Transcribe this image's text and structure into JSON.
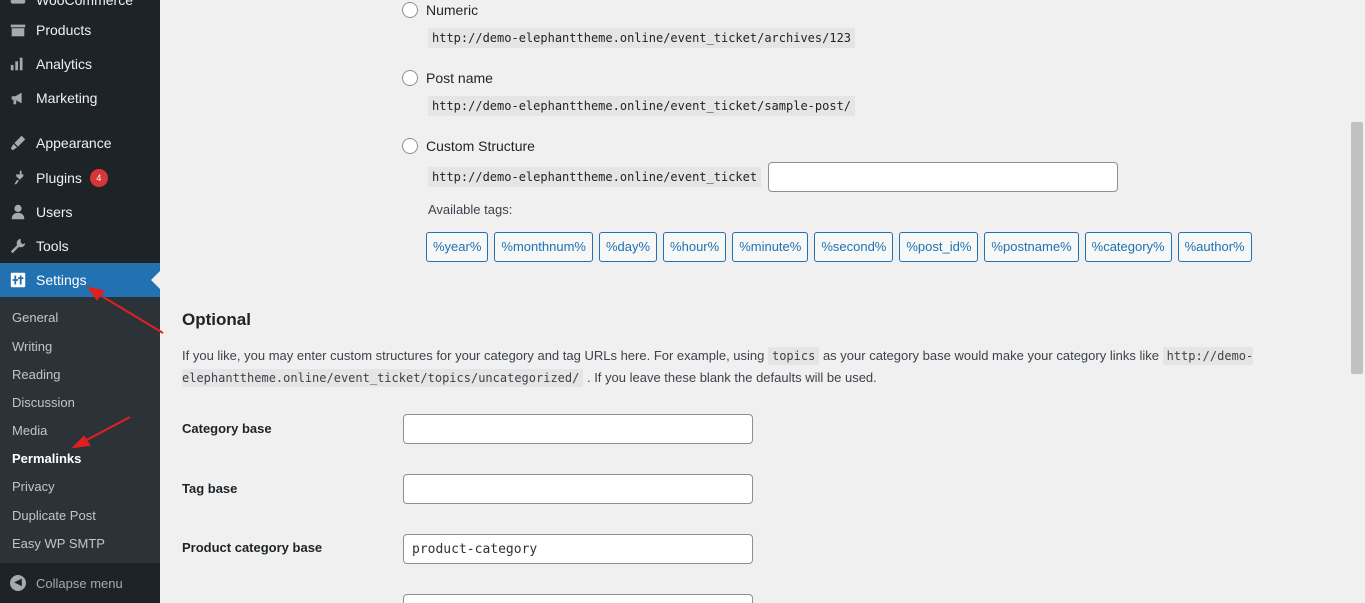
{
  "sidebar": {
    "items": [
      {
        "label": "WooCommerce",
        "icon": "woocommerce-icon"
      },
      {
        "label": "Products",
        "icon": "products-icon"
      },
      {
        "label": "Analytics",
        "icon": "analytics-icon"
      },
      {
        "label": "Marketing",
        "icon": "marketing-icon"
      },
      {
        "label": "Appearance",
        "icon": "appearance-icon"
      },
      {
        "label": "Plugins",
        "icon": "plugins-icon",
        "badge": "4"
      },
      {
        "label": "Users",
        "icon": "users-icon"
      },
      {
        "label": "Tools",
        "icon": "tools-icon"
      },
      {
        "label": "Settings",
        "icon": "settings-icon"
      }
    ],
    "submenu": [
      "General",
      "Writing",
      "Reading",
      "Discussion",
      "Media",
      "Permalinks",
      "Privacy",
      "Duplicate Post",
      "Easy WP SMTP"
    ],
    "current_submenu": "Permalinks",
    "collapse_label": "Collapse menu",
    "active_color": "#2271b1",
    "badge_color": "#d63638"
  },
  "permalink_options": [
    {
      "label": "Numeric",
      "example": "http://demo-elephanttheme.online/event_ticket/archives/123"
    },
    {
      "label": "Post name",
      "example": "http://demo-elephanttheme.online/event_ticket/sample-post/"
    },
    {
      "label": "Custom Structure",
      "prefix": "http://demo-elephanttheme.online/event_ticket",
      "value": ""
    }
  ],
  "available_tags_label": "Available tags:",
  "tags": [
    "%year%",
    "%monthnum%",
    "%day%",
    "%hour%",
    "%minute%",
    "%second%",
    "%post_id%",
    "%postname%",
    "%category%",
    "%author%"
  ],
  "optional": {
    "heading": "Optional",
    "desc_part1": "If you like, you may enter custom structures for your category and tag URLs here. For example, using ",
    "desc_code1": "topics",
    "desc_part2": " as your category base would make your category links like ",
    "desc_code2": "http://demo-elephanttheme.online/event_ticket/topics/uncategorized/",
    "desc_part3": " . If you leave these blank the defaults will be used.",
    "fields": [
      {
        "label": "Category base",
        "value": ""
      },
      {
        "label": "Tag base",
        "value": ""
      },
      {
        "label": "Product category base",
        "value": "product-category"
      }
    ]
  }
}
